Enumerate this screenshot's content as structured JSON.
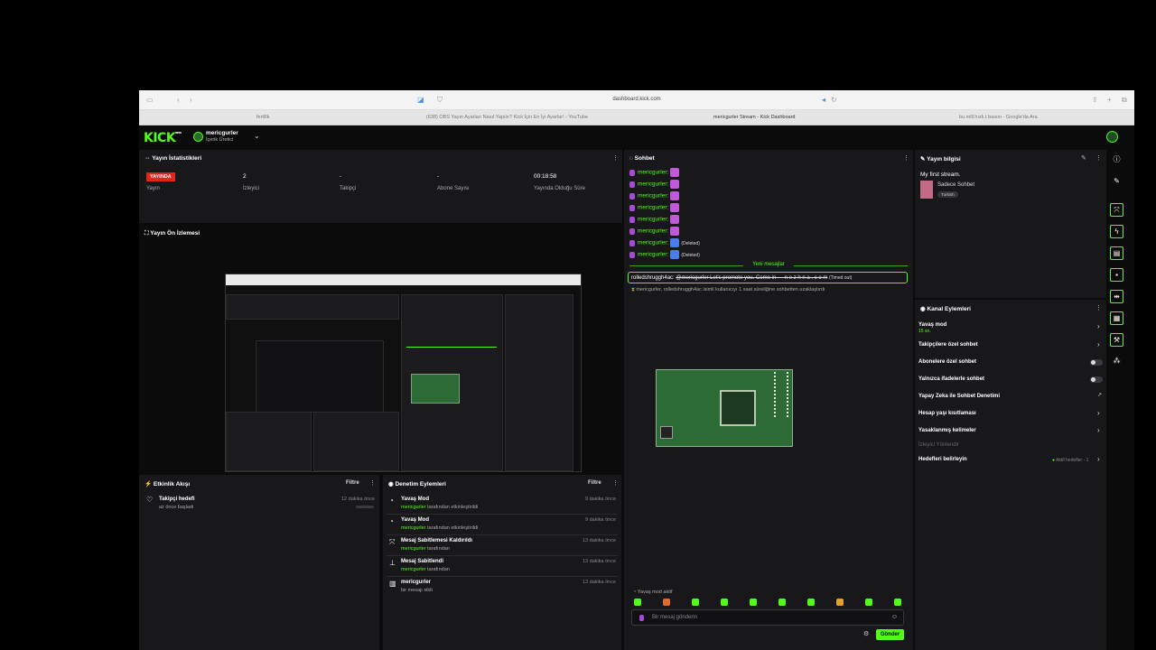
{
  "browser": {
    "url": "dashboard.kick.com",
    "tabs": [
      "fertillk",
      "(638) OBS Yayın Ayarları Nasıl Yapılır? Kick İçin En İyi Ayarlar! - YouTube",
      "mericgurler Stream - Kick Dashboard",
      "bu.mill.hızlı.t basını - Google'da Ara"
    ]
  },
  "header": {
    "logo": "KICK",
    "logo_sup": "BETA",
    "username": "mericgurler",
    "role": "İçerik Üretici"
  },
  "stats": {
    "title": "Yayın İstatistikleri",
    "live_badge": "YAYINDA",
    "items": [
      {
        "value": "",
        "label": "Yayın"
      },
      {
        "value": "2",
        "label": "İzleyici"
      },
      {
        "value": "-",
        "label": "Takipçi"
      },
      {
        "value": "-",
        "label": "Abone Sayısı"
      },
      {
        "value": "00:18:58",
        "label": "Yayında Olduğu Süre"
      }
    ]
  },
  "preview": {
    "title": "Yayın Ön İzlemesi"
  },
  "activity": {
    "title": "Etkinlik Akışı",
    "filter": "Filtre",
    "items": [
      {
        "title": "Takipçi hedefi",
        "sub": "az önce başladı",
        "time": "12 dakika önce"
      }
    ]
  },
  "moderation": {
    "title": "Denetim Eylemleri",
    "filter": "Filtre",
    "items": [
      {
        "title": "Yavaş Mod",
        "user": "mericgurler",
        "sub": "tarafından etkinleştirildi",
        "time": "9 dakika önce"
      },
      {
        "title": "Yavaş Mod",
        "user": "mericgurler",
        "sub": "tarafından etkinleştirildi",
        "time": "9 dakika önce"
      },
      {
        "title": "Mesaj Sabitlemesi Kaldırıldı",
        "user": "mericgurler",
        "sub": "tarafından",
        "time": "13 dakika önce"
      },
      {
        "title": "Mesaj Sabitlendi",
        "user": "mericgurler",
        "sub": "tarafından",
        "time": "13 dakika önce"
      },
      {
        "title": "mericgurler",
        "user": "",
        "sub": "bir mesajı sildi",
        "time": "13 dakika önce"
      }
    ]
  },
  "chat": {
    "title": "Sohbet",
    "messages": [
      {
        "user": "mericgurler:",
        "deleted": ""
      },
      {
        "user": "mericgurler:",
        "deleted": ""
      },
      {
        "user": "mericgurler:",
        "deleted": ""
      },
      {
        "user": "mericgurler:",
        "deleted": ""
      },
      {
        "user": "mericgurler:",
        "deleted": ""
      },
      {
        "user": "mericgurler:",
        "deleted": ""
      },
      {
        "user": "mericgurler:",
        "deleted": "(Deleted)"
      },
      {
        "user": "mericgurler:",
        "deleted": "(Deleted)"
      }
    ],
    "new_messages": "Yeni mesajlar",
    "highlight_user": "rolledshruggh4ac:",
    "highlight_text": "@mericgurler Let's promote you. Come in — n e z h n a . c o m",
    "highlight_status": "(Timed out)",
    "timeout_text": "mericgurler, rolledshruggh4ac isimli kullanıcıyı 1 saat süreliğine sohbetten uzaklaştırdı",
    "slow_mode": "Yavaş mod aktif",
    "input_placeholder": "Bir mesaj gönderin",
    "send_label": "Gönder"
  },
  "info": {
    "title": "Yayın bilgisi",
    "stream_title": "My first stream.",
    "category": "Sadece Sohbet",
    "tag": "Turkish"
  },
  "channel_actions": {
    "title": "Kanal Eylemleri",
    "items": [
      {
        "label": "Yavaş mod",
        "sub": "15 sn.",
        "control": "arrow"
      },
      {
        "label": "Takipçilere özel sohbet",
        "sub": "",
        "control": "arrow"
      },
      {
        "label": "Abonelere özel sohbet",
        "sub": "",
        "control": "toggle"
      },
      {
        "label": "Yalnızca ifadelerle sohbet",
        "sub": "",
        "control": "toggle"
      },
      {
        "label": "Yapay Zeka ile Sohbet Denetimi",
        "sub": "",
        "control": "external"
      },
      {
        "label": "Hesap yaşı kısıtlaması",
        "sub": "",
        "control": "arrow"
      },
      {
        "label": "Yasaklanmış kelimeler",
        "sub": "",
        "control": "arrow"
      },
      {
        "label": "İzleyici Yönlendir",
        "sub": "",
        "control": "none"
      },
      {
        "label": "Hedefleri belirleyin",
        "sub": "",
        "control": "arrow"
      }
    ],
    "goal_status": "Aktif hedefler - 1"
  },
  "colors": {
    "accent": "#53fc18",
    "live": "#e0251b",
    "panel": "#18181b"
  }
}
